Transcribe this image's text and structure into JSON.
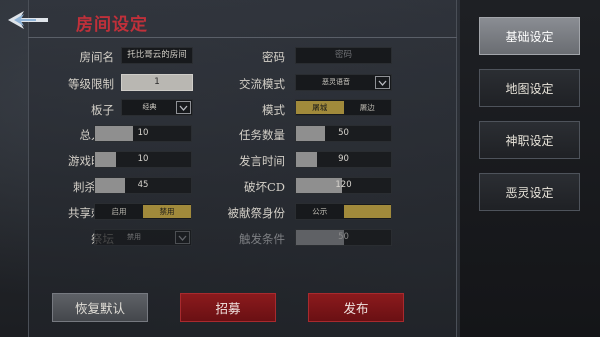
{
  "title": "房间设定",
  "rows": [
    {
      "left_label": "房间名",
      "left_value": "托比哥云的房间",
      "right_label": "密码",
      "right_placeholder": "密码"
    },
    {
      "left_label": "等级限制",
      "left_value": "1",
      "right_label": "交流模式",
      "right_value": "恶灵语音"
    },
    {
      "left_label": "板子",
      "left_value": "经典",
      "right_label": "模式",
      "right_options": [
        "屠城",
        "屠边"
      ],
      "right_selected": "屠城"
    },
    {
      "left_label": "总人数",
      "left_value": "10",
      "left_fraction": 0.4,
      "right_label": "任务数量",
      "right_value": "50",
      "right_fraction": 0.3
    },
    {
      "left_label": "游戏时间",
      "left_value": "10",
      "left_fraction": 0.22,
      "right_label": "发言时间",
      "right_value": "90",
      "right_fraction": 0.22
    },
    {
      "left_label": "刺杀CD",
      "left_value": "45",
      "left_fraction": 0.31,
      "right_label": "破坏CD",
      "right_value": "120",
      "right_fraction": 0.48
    },
    {
      "left_label": "共享刺杀",
      "left_options": [
        "启用",
        "禁用"
      ],
      "left_selected": "禁用",
      "right_label": "被献祭身份",
      "right_options": [
        "公示",
        ""
      ],
      "right_selected": ""
    },
    {
      "left_label": "祭坛",
      "left_value": "禁用",
      "right_label": "触发条件",
      "right_value": "50",
      "right_fraction": 0.5
    }
  ],
  "buttons": {
    "reset": "恢复默认",
    "recruit": "招募",
    "publish": "发布"
  },
  "tabs": [
    {
      "label": "基础设定",
      "active": true
    },
    {
      "label": "地图设定",
      "active": false
    },
    {
      "label": "神职设定",
      "active": false
    },
    {
      "label": "恶灵设定",
      "active": false
    }
  ],
  "colors": {
    "title": "#c0303a",
    "toggle_on": "#a18a3b",
    "button_red": "#8b1a1d",
    "tab_active": "#8a8d93"
  }
}
